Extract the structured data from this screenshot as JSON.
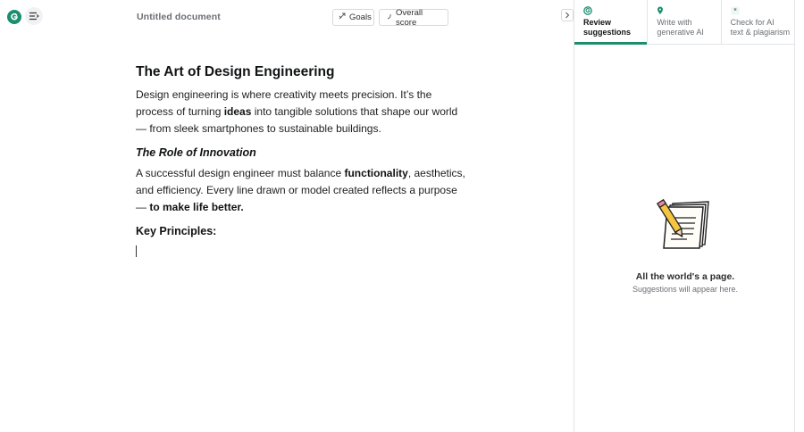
{
  "header": {
    "document_title": "Untitled document",
    "goals_label": "Goals",
    "overall_score_label": "Overall score"
  },
  "document": {
    "heading": "The Art of Design Engineering",
    "p1_a": "Design engineering is where creativity meets precision. It’s the process of turning ",
    "p1_b": "ideas",
    "p1_c": " into tangible solutions that shape our world — from sleek smartphones to sustainable buildings.",
    "subheading": "The Role of Innovation",
    "p2_a": "A successful design engineer must balance ",
    "p2_b": "functionality",
    "p2_c": ", aesthetics, and efficiency. Every line drawn or model created reflects a purpose — ",
    "p2_d": "to make life better.",
    "key_principles": "Key Principles:"
  },
  "panel": {
    "tabs": [
      {
        "line1": "Review",
        "line2": "suggestions",
        "active": true
      },
      {
        "line1": "Write with",
        "line2": "generative AI",
        "active": false
      },
      {
        "line1": "Check for AI",
        "line2": "text & plagiarism",
        "active": false
      }
    ],
    "empty_title": "All the world's a page.",
    "empty_subtitle": "Suggestions will appear here."
  },
  "colors": {
    "brand": "#1b8e6f",
    "text": "#101214",
    "muted": "#6b6e73",
    "border": "#e3e4e6"
  },
  "icons": [
    "grammarly-logo-icon",
    "menu-collapse-icon",
    "goals-icon",
    "score-icon",
    "chevron-right-icon",
    "review-icon",
    "generative-ai-icon",
    "plagiarism-icon",
    "notepad-pencil-icon"
  ]
}
